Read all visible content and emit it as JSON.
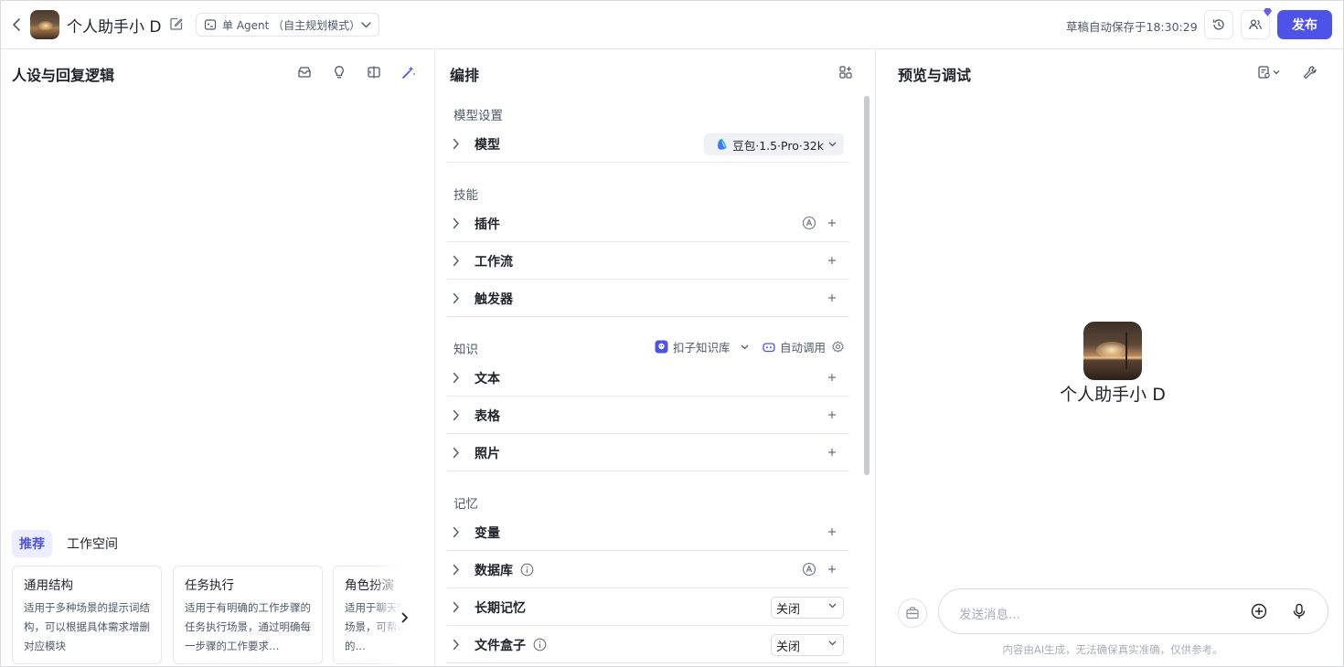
{
  "header": {
    "app_title": "个人助手小 D",
    "mode_label": "单 Agent （自主规划模式）",
    "autosave_text": "草稿自动保存于18:30:29",
    "publish_label": "发布",
    "accent_color": "#4d53e8"
  },
  "left": {
    "title": "人设与回复逻辑",
    "tabs": [
      "推荐",
      "工作空间"
    ],
    "cards": [
      {
        "title": "通用结构",
        "desc": "适用于多种场景的提示词结构，可以根据具体需求增删对应模块"
      },
      {
        "title": "任务执行",
        "desc": "适用于有明确的工作步骤的任务执行场景，通过明确每一步骤的工作要求…"
      },
      {
        "title": "角色扮演",
        "desc": "适用于聊天陪伴、互动娱乐场景，可帮助塑造个性化的…"
      }
    ]
  },
  "middle": {
    "title": "编排",
    "sections": {
      "model_settings": "模型设置",
      "skills": "技能",
      "knowledge": "知识",
      "memory": "记忆"
    },
    "model": {
      "label": "模型",
      "value": "豆包·1.5·Pro·32k"
    },
    "skills": [
      "插件",
      "工作流",
      "触发器"
    ],
    "knowledge_base_label": "扣子知识库",
    "auto_call_label": "自动调用",
    "knowledge": [
      "文本",
      "表格",
      "照片"
    ],
    "memory": {
      "variables": "变量",
      "database": "数据库",
      "long_term": "长期记忆",
      "long_term_value": "关闭",
      "filebox": "文件盒子",
      "filebox_value": "关闭"
    }
  },
  "right": {
    "title": "预览与调试",
    "bot_name": "个人助手小 D",
    "input_placeholder": "发送消息...",
    "disclaimer": "内容由AI生成，无法确保真实准确，仅供参考。"
  }
}
